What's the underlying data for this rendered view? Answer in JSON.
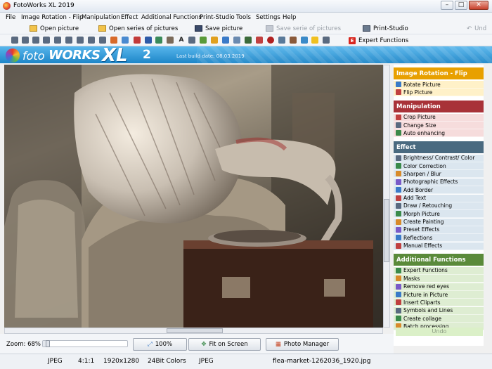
{
  "window": {
    "title": "FotoWorks XL 2019"
  },
  "menu": [
    "File",
    "Image Rotation - Flip",
    "Manipulation",
    "Effect",
    "Additional Functions",
    "Print-Studio",
    "Tools",
    "Settings",
    "Help"
  ],
  "toolbar": {
    "open_picture": "Open picture",
    "open_series": "Open series of pictures",
    "save_picture": "Save picture",
    "save_series": "Save serie of pictures",
    "print_studio": "Print-Studio",
    "undo": "Und",
    "expert_functions": "Expert Functions"
  },
  "banner": {
    "foto": "foto",
    "works": "WORKS",
    "xl": "XL",
    "version": "2",
    "build": "Last build date: 08.03.2019"
  },
  "sidepanel": {
    "sections": [
      {
        "title": "Image Rotation - Flip",
        "color": "#e8a000",
        "items": [
          "Rotate Picture",
          "Flip Picture"
        ]
      },
      {
        "title": "Manipulation",
        "color": "#a83238",
        "items": [
          "Crop Picture",
          "Change Size",
          "Auto enhancing"
        ]
      },
      {
        "title": "Effect",
        "color": "#4a6a80",
        "items": [
          "Brightness/ Contrast/ Color",
          "Color Correction",
          "Sharpen / Blur",
          "Photographic Effects",
          "Add Border",
          "Add Text",
          "Draw / Retouching",
          "Morph Picture",
          "Create Painting",
          "Preset Effects",
          "Reflections",
          "Manual Effects"
        ]
      },
      {
        "title": "Additional Functions",
        "color": "#5a8a3a",
        "items": [
          "Expert Functions",
          "Masks",
          "Remove red eyes",
          "Picture in Picture",
          "Insert Cliparts",
          "Symbols and Lines",
          "Create collage",
          "Batch processing"
        ]
      }
    ],
    "undo": "Undo"
  },
  "bottom": {
    "zoom_label": "Zoom: 68%",
    "zoom_value": 0.68,
    "btn_100": "100%",
    "btn_fit": "Fit on Screen",
    "btn_manager": "Photo Manager"
  },
  "status": {
    "format": "JPEG",
    "ratio": "4:1:1",
    "size": "1920x1280",
    "colors": "24Bit Colors",
    "type": "JPEG",
    "filename": "flea-market-1262036_1920.jpg"
  }
}
